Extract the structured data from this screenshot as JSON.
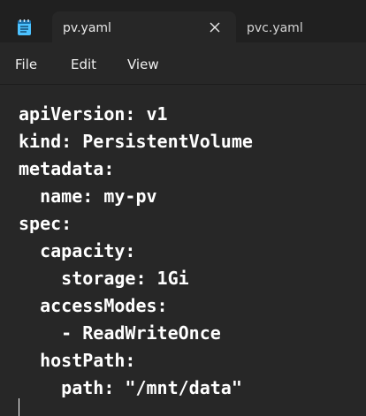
{
  "icons": {
    "app": "notepad-icon",
    "close": "close-icon"
  },
  "tabs": [
    {
      "label": "pv.yaml",
      "active": true
    },
    {
      "label": "pvc.yaml",
      "active": false
    }
  ],
  "menu": {
    "file": "File",
    "edit": "Edit",
    "view": "View"
  },
  "editor": {
    "lines": [
      "apiVersion: v1",
      "kind: PersistentVolume",
      "metadata:",
      "  name: my-pv",
      "spec:",
      "  capacity:",
      "    storage: 1Gi",
      "  accessModes:",
      "    - ReadWriteOnce",
      "  hostPath:",
      "    path: \"/mnt/data\""
    ]
  },
  "colors": {
    "background": "#272727",
    "tabstrip": "#202020",
    "text": "#ffffff",
    "accent": "#4cc2ff"
  }
}
